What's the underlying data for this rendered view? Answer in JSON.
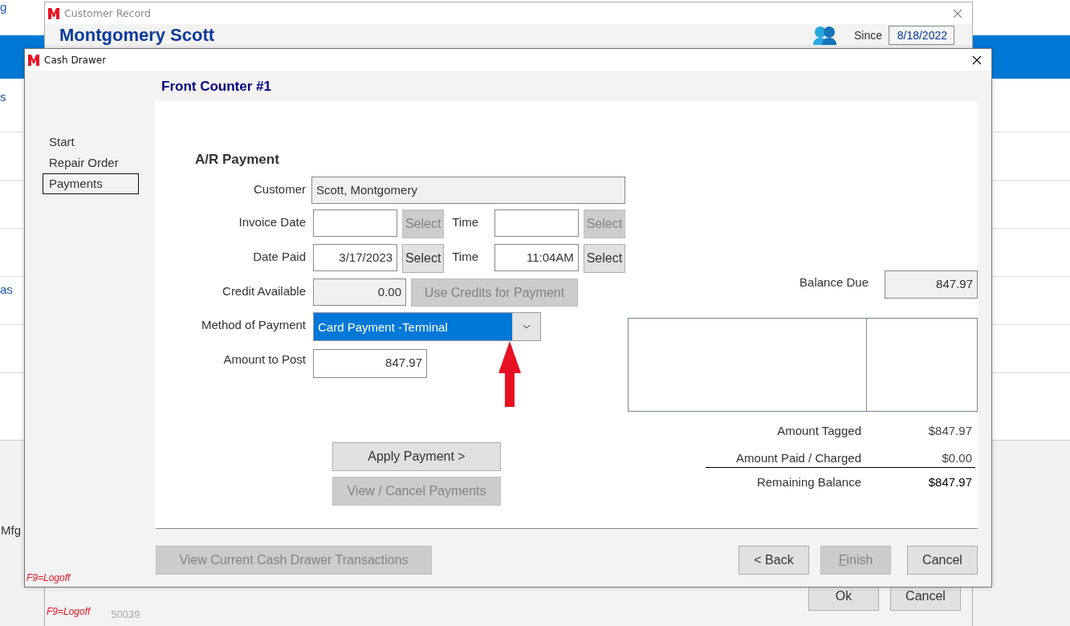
{
  "background": {
    "left_edge_fragments": [
      "g",
      "s",
      "as",
      "Mfg"
    ]
  },
  "customer_record": {
    "title": "Customer Record",
    "name": "Montgomery Scott",
    "since_label": "Since",
    "since_value": "8/18/2022",
    "buttons": [
      {
        "label": "Ok"
      },
      {
        "label": "Cancel"
      }
    ],
    "hotkey_hint": "F9=Logoff",
    "footer_number": "50039"
  },
  "cash_drawer": {
    "title": "Cash Drawer",
    "heading": "Front Counter #1",
    "nav": [
      {
        "label": "Start",
        "selected": false
      },
      {
        "label": "Repair Order",
        "selected": false
      },
      {
        "label": "Payments",
        "selected": true
      }
    ],
    "section_title": "A/R Payment",
    "customer": {
      "label": "Customer",
      "value": "Scott, Montgomery"
    },
    "date_rows": [
      {
        "label": "Invoice Date",
        "select_button": {
          "label": "Select",
          "disabled": true
        },
        "time_label": "Time",
        "time_select": {
          "label": "Select",
          "disabled": true
        }
      },
      {
        "label": "Date Paid",
        "date": "3/17/2023",
        "select_button": {
          "label": "Select",
          "disabled": false
        },
        "time_label": "Time",
        "time": "11:04AM",
        "time_select": {
          "label": "Select",
          "disabled": false
        }
      }
    ],
    "credit": {
      "label": "Credit Available",
      "value": "0.00",
      "button": {
        "label": "Use Credits for Payment",
        "disabled": true
      }
    },
    "method": {
      "label": "Method of Payment",
      "value": "Card Payment -Terminal",
      "focused": true
    },
    "amount": {
      "label": "Amount to Post",
      "value": "847.97"
    },
    "actions": [
      {
        "label": "Apply Payment >",
        "disabled": false
      },
      {
        "label": "View / Cancel Payments",
        "disabled": true
      }
    ],
    "balance_due": {
      "label": "Balance Due",
      "value": "847.97"
    },
    "totals": [
      {
        "label": "Amount Tagged",
        "value": "$847.97",
        "emphasis": false,
        "rule_above": false
      },
      {
        "label": "Amount Paid / Charged",
        "value": "$0.00",
        "emphasis": false,
        "rule_above": false
      },
      {
        "label": "Remaining Balance",
        "value": "$847.97",
        "emphasis": true,
        "rule_above": true
      }
    ],
    "footer": {
      "left_button": {
        "label": "View Current Cash Drawer Transactions",
        "disabled": true
      },
      "buttons": [
        {
          "label": "< Back",
          "disabled": false,
          "mnemonic": false
        },
        {
          "label": "Finish",
          "disabled": true,
          "mnemonic": true
        },
        {
          "label": "Cancel",
          "disabled": false,
          "mnemonic": false
        }
      ],
      "hotkey_hint": "F9=Logoff"
    }
  }
}
